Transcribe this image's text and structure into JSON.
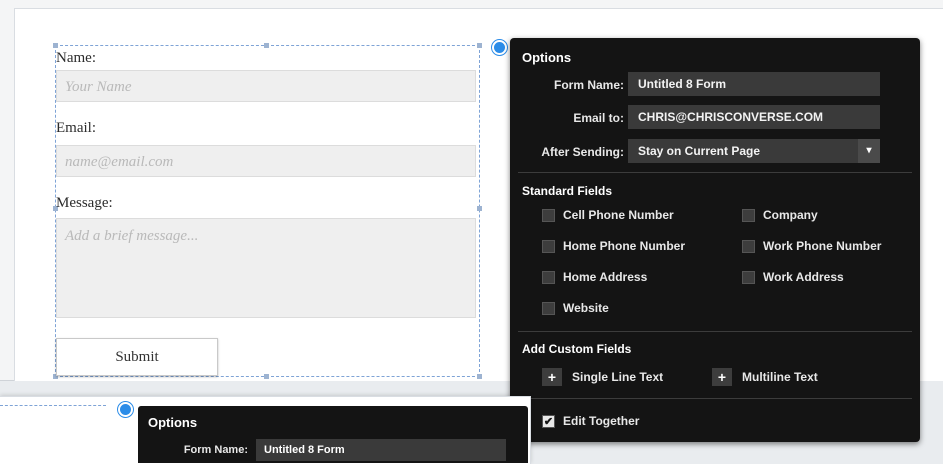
{
  "form": {
    "name_label": "Name:",
    "name_placeholder": "Your Name",
    "email_label": "Email:",
    "email_placeholder": "name@email.com",
    "message_label": "Message:",
    "message_placeholder": "Add a brief message...",
    "submit_label": "Submit"
  },
  "options": {
    "title": "Options",
    "form_name_label": "Form Name:",
    "form_name_value": "Untitled 8 Form",
    "email_to_label": "Email to:",
    "email_to_value": "CHRIS@CHRISCONVERSE.COM",
    "after_sending_label": "After Sending:",
    "after_sending_value": "Stay on Current Page",
    "standard_fields_title": "Standard Fields",
    "standard_fields": [
      {
        "label": "Cell Phone Number",
        "checked": false
      },
      {
        "label": "Company",
        "checked": false
      },
      {
        "label": "Home Phone Number",
        "checked": false
      },
      {
        "label": "Work Phone Number",
        "checked": false
      },
      {
        "label": "Home Address",
        "checked": false
      },
      {
        "label": "Work Address",
        "checked": false
      },
      {
        "label": "Website",
        "checked": false
      }
    ],
    "custom_fields_title": "Add Custom Fields",
    "single_line_label": "Single Line Text",
    "multiline_label": "Multiline Text",
    "edit_together_label": "Edit Together",
    "edit_together_checked": true
  },
  "options_copy": {
    "title": "Options",
    "form_name_label": "Form Name:",
    "form_name_value": "Untitled 8 Form"
  },
  "colors": {
    "panel_bg": "#141414",
    "field_bg": "#3a3a3a",
    "anchor_blue": "#2b8ce8",
    "selection_border": "#7ea3d6"
  },
  "icons": {
    "select_arrow": "chevron-down-icon",
    "add": "plus-icon",
    "check": "check-icon"
  }
}
